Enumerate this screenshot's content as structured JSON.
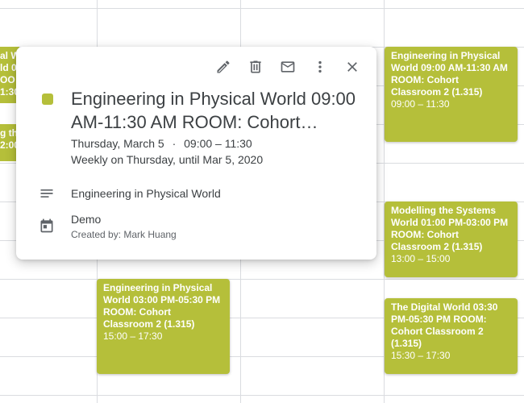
{
  "colors": {
    "event": "#b5bf3a",
    "grid": "#dadce0",
    "text": "#3c4043",
    "icon": "#5f6368"
  },
  "background_fragments": {
    "top_left": [
      "al W",
      "ld 0",
      "OO",
      "1:30"
    ],
    "mid_left": [
      "g the",
      "2:00"
    ]
  },
  "events": [
    {
      "title": "Engineering in Physical World 09:00 AM-11:30 AM ROOM: Cohort Classroom 2 (1.315)",
      "time": "09:00 – 11:30"
    },
    {
      "title": "Modelling the Systems World 01:00 PM-03:00 PM ROOM: Cohort Classroom 2 (1.315)",
      "time": "13:00 – 15:00"
    },
    {
      "title": "The Digital World 03:30 PM-05:30 PM ROOM: Cohort Classroom 2 (1.315)",
      "time": "15:30 – 17:30"
    },
    {
      "title": "Engineering in Physical World 03:00 PM-05:30 PM ROOM: Cohort Classroom 2 (1.315)",
      "time": "15:00 – 17:30"
    }
  ],
  "popup": {
    "toolbar": {
      "edit": "pencil-icon",
      "delete": "trash-icon",
      "email": "envelope-icon",
      "options": "more-vertical-icon",
      "close": "close-icon"
    },
    "title": "Engineering in Physical World 09:00 AM-11:30 AM ROOM: Cohort…",
    "date": "Thursday, March 5",
    "separator": "·",
    "time": "09:00 – 11:30",
    "recurrence": "Weekly on Thursday, until Mar 5, 2020",
    "description": "Engineering in Physical World",
    "calendar": "Demo",
    "creator": "Created by: Mark Huang"
  }
}
